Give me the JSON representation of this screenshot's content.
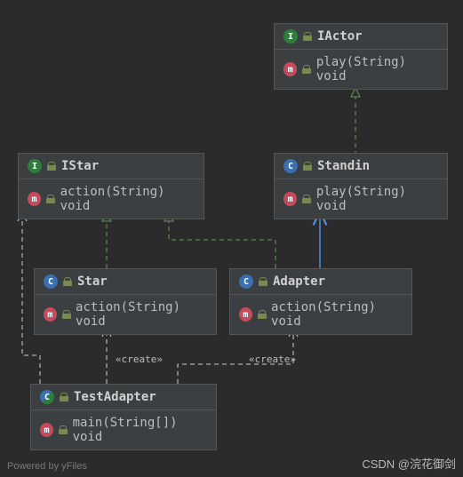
{
  "classes": {
    "IActor": {
      "name": "IActor",
      "kind": "interface",
      "members": [
        "play(String) void"
      ]
    },
    "IStar": {
      "name": "IStar",
      "kind": "interface",
      "members": [
        "action(String) void"
      ]
    },
    "Standin": {
      "name": "Standin",
      "kind": "class",
      "members": [
        "play(String) void"
      ]
    },
    "Star": {
      "name": "Star",
      "kind": "class",
      "members": [
        "action(String) void"
      ]
    },
    "Adapter": {
      "name": "Adapter",
      "kind": "class",
      "members": [
        "action(String) void"
      ]
    },
    "TestAdapter": {
      "name": "TestAdapter",
      "kind": "classmain",
      "members": [
        "main(String[]) void"
      ]
    }
  },
  "stereotypes": {
    "create1": "«create»",
    "create2": "«create»"
  },
  "watermarks": {
    "left": "Powered by yFiles",
    "right": "CSDN @浣花御剑"
  },
  "relations": {
    "description": "UML class diagram for Adapter design pattern",
    "implements": [
      {
        "from": "Star",
        "to": "IStar"
      },
      {
        "from": "Adapter",
        "to": "IStar"
      },
      {
        "from": "Standin",
        "to": "IActor"
      }
    ],
    "extends_or_uses": [
      {
        "from": "Adapter",
        "to": "Standin",
        "style": "solid-blue-open-arrow"
      }
    ],
    "dependencies": [
      {
        "from": "TestAdapter",
        "to": "IStar"
      },
      {
        "from": "TestAdapter",
        "to": "Star",
        "stereotype": "«create»"
      },
      {
        "from": "TestAdapter",
        "to": "Adapter",
        "stereotype": "«create»"
      }
    ]
  }
}
